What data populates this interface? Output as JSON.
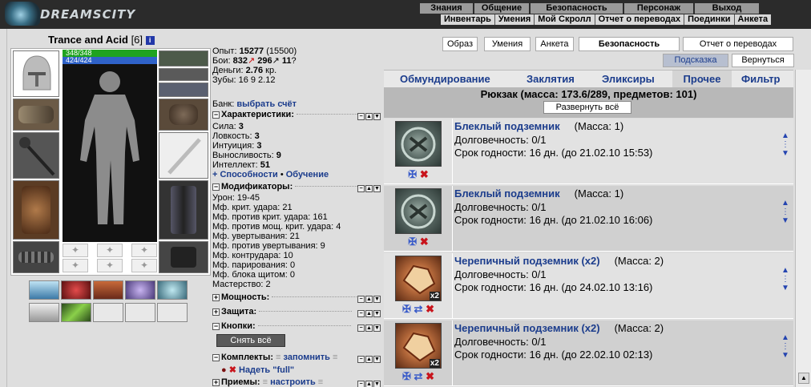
{
  "brand": {
    "logo_text": "DREAMSCITY"
  },
  "menu_top": [
    "Знания",
    "Общение",
    "Безопасность",
    "Персонаж",
    "Выход"
  ],
  "menu_sub": [
    "Инвентарь",
    "Умения",
    "Мой Скролл",
    "Отчет о переводах",
    "Поединки",
    "Анкета"
  ],
  "character": {
    "name": "Trance and Acid",
    "level": "[6]",
    "info_icon": "i",
    "hp": "348/348",
    "mana": "424/424"
  },
  "stats": {
    "exp_label": "Опыт:",
    "exp": "15277",
    "exp_next": "(15500)",
    "fights_label": "Бои:",
    "wins": "832",
    "losses": "296",
    "draws": "11",
    "money_label": "Деньги:",
    "money": "2.76",
    "money_unit": "кр.",
    "teeth_label": "Зубы:",
    "teeth_text": "16 9 2.12",
    "bank_label": "Банк:",
    "bank_link": "выбрать счёт"
  },
  "sections": {
    "characteristics": "Характеристики:",
    "attrs": [
      {
        "k": "Сила:",
        "v": "3"
      },
      {
        "k": "Ловкость:",
        "v": "3"
      },
      {
        "k": "Интуиция:",
        "v": "3"
      },
      {
        "k": "Выносливость:",
        "v": "9"
      },
      {
        "k": "Интеллект:",
        "v": "51"
      }
    ],
    "abilities_link": "+ Способности",
    "training_link": "Обучение",
    "modifiers": "Модификаторы:",
    "mods": [
      "Урон: 19-45",
      "Мф. крит. удара: 21",
      "Мф. против крит. удара: 161",
      "Мф. против мощ. крит. удара: 4",
      "Мф. увертывания: 21",
      "Мф. против увертывания: 9",
      "Мф. контрудара: 10",
      "Мф. парирования: 0",
      "Мф. блока щитом: 0",
      "Мастерство: 2"
    ],
    "power": "Мощность:",
    "defense": "Защита:",
    "buttons": "Кнопки:",
    "remove_all": "Снять всё",
    "sets": "Комплекты:",
    "remember": "запомнить",
    "wear_full": "Надеть \"full\"",
    "techniques": "Приемы:",
    "configure": "настроить"
  },
  "top_tabs": [
    "Образ",
    "Умения",
    "Анкета",
    "Безопасность",
    "Отчет о переводах"
  ],
  "hint_btn": "Подсказка",
  "return_btn": "Вернуться",
  "inv_tabs": [
    "Обмундирование",
    "Заклятия",
    "Эликсиры",
    "Прочее",
    "Фильтр"
  ],
  "inventory": {
    "title": "Рюкзак (масса: 173.6/289, предметов: 101)",
    "expand": "Развернуть всё",
    "items": [
      {
        "name": "Блеклый подземник",
        "mass": "(Масса: 1)",
        "durability": "Долговечность: 0/1",
        "expiry": "Срок годности: 16 дн. (до 21.02.10 15:53)",
        "qty": "",
        "actions": [
          "✠",
          "✖"
        ]
      },
      {
        "name": "Блеклый подземник",
        "mass": "(Масса: 1)",
        "durability": "Долговечность: 0/1",
        "expiry": "Срок годности: 16 дн. (до 21.02.10 16:06)",
        "qty": "",
        "actions": [
          "✠",
          "✖"
        ]
      },
      {
        "name": "Черепичный подземник (x2)",
        "mass": "(Масса: 2)",
        "durability": "Долговечность: 0/1",
        "expiry": "Срок годности: 16 дн. (до 24.02.10 13:16)",
        "qty": "x2",
        "actions": [
          "✠",
          "⇄",
          "✖"
        ]
      },
      {
        "name": "Черепичный подземник (x2)",
        "mass": "(Масса: 2)",
        "durability": "Долговечность: 0/1",
        "expiry": "Срок годности: 16 дн. (до 22.02.10 02:13)",
        "qty": "x2",
        "actions": [
          "✠",
          "⇄",
          "✖"
        ]
      }
    ]
  },
  "colors": {
    "hp": "#1fa31f",
    "mana": "#2f62c8",
    "link": "#1b3c8c"
  }
}
